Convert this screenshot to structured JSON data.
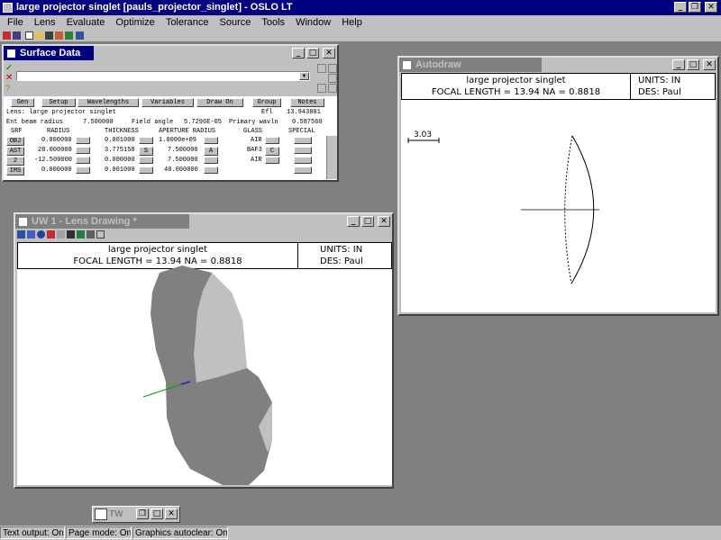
{
  "app": {
    "title": "large projector singlet [pauls_projector_singlet] - OSLO LT"
  },
  "menu": [
    "File",
    "Lens",
    "Evaluate",
    "Optimize",
    "Tolerance",
    "Source",
    "Tools",
    "Window",
    "Help"
  ],
  "surface_data": {
    "title": "Surface Data",
    "buttons": [
      "Gen",
      "Setup",
      "Wavelengths",
      "Variables",
      "Draw On",
      "Group",
      "Notes"
    ],
    "lens_label": "Lens: large projector singlet",
    "efl_label": "Efl",
    "efl_value": "13.943801",
    "ebr_label": "Ent beam radius",
    "ebr_value": "7.500000",
    "field_label": "Field angle",
    "field_value": "5.7296E-05",
    "wavln_label": "Primary wavln",
    "wavln_value": "0.587560",
    "columns": [
      "SRF",
      "RADIUS",
      "THICKNESS",
      "APERTURE RADIUS",
      "GLASS",
      "SPECIAL"
    ],
    "rows": [
      {
        "srf": "OBJ",
        "radius": "0.000000",
        "thickness": "0.001000",
        "aperture": "1.0000e+09",
        "glass": "AIR",
        "tflag": "",
        "aflag": "",
        "gflag": ""
      },
      {
        "srf": "AST",
        "radius": "28.000000",
        "thickness": "3.775158",
        "aperture": "7.500000",
        "glass": "BAF3",
        "tflag": "S",
        "aflag": "A",
        "gflag": "C"
      },
      {
        "srf": "2",
        "radius": "-12.500000",
        "thickness": "0.000000",
        "aperture": "7.500000",
        "glass": "AIR",
        "tflag": "",
        "aflag": "",
        "gflag": ""
      },
      {
        "srf": "IMS",
        "radius": "0.000000",
        "thickness": "0.001000",
        "aperture": "40.000000",
        "glass": "",
        "tflag": "",
        "aflag": "",
        "gflag": ""
      }
    ]
  },
  "autodraw": {
    "title": "Autodraw",
    "lens_name": "large projector singlet",
    "focal_line": "FOCAL LENGTH = 13.94   NA = 0.8818",
    "units": "UNITS: IN",
    "designer": "DES: Paul",
    "scale": "3.03"
  },
  "lens_drawing": {
    "title": "UW 1 - Lens Drawing *",
    "lens_name": "large projector singlet",
    "focal_line": "FOCAL LENGTH = 13.94   NA = 0.8818",
    "units": "UNITS: IN",
    "designer": "DES: Paul"
  },
  "minimized": {
    "label": "TW"
  },
  "status": [
    "Text output: On",
    "Page mode: On",
    "Graphics autoclear: On"
  ],
  "colors": {
    "title_active": "#000080",
    "title_inactive": "#808080",
    "lens_dark": "#808080",
    "lens_light": "#c0c0c0"
  }
}
